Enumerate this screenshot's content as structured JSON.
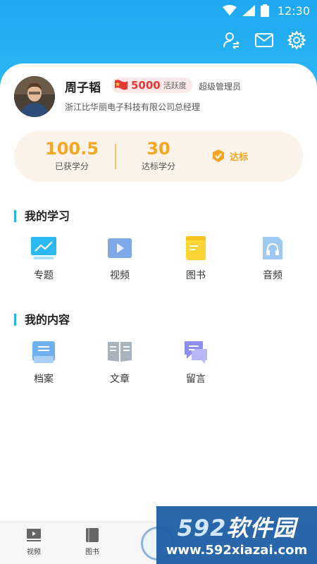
{
  "status": {
    "time": "12:30"
  },
  "profile": {
    "name": "周子韬",
    "activity_value": "5000",
    "activity_label": "活跃度",
    "role": "超级管理员",
    "company": "浙江比华丽电子科技有限公司总经理"
  },
  "scores": {
    "earned_value": "100.5",
    "earned_label": "已获学分",
    "required_value": "30",
    "required_label": "达标学分",
    "reach_label": "达标"
  },
  "study": {
    "title": "我的学习",
    "items": [
      {
        "label": "专题",
        "icon": "topic-icon"
      },
      {
        "label": "视频",
        "icon": "video-icon"
      },
      {
        "label": "图书",
        "icon": "book-icon"
      },
      {
        "label": "音频",
        "icon": "audio-icon"
      }
    ]
  },
  "content": {
    "title": "我的内容",
    "items": [
      {
        "label": "档案",
        "icon": "archive-icon"
      },
      {
        "label": "文章",
        "icon": "article-icon"
      },
      {
        "label": "留言",
        "icon": "message-icon"
      }
    ]
  },
  "bottom_nav": {
    "items": [
      {
        "label": "视频"
      },
      {
        "label": "图书"
      }
    ]
  },
  "watermark": {
    "brand_num": "592",
    "brand_text": "软件园",
    "url": "www.592xiazai.com"
  },
  "colors": {
    "header": "#1fa8ef",
    "accent_orange": "#f5a623",
    "activity_red": "#e53935",
    "section_bar": "#22b4f1"
  }
}
